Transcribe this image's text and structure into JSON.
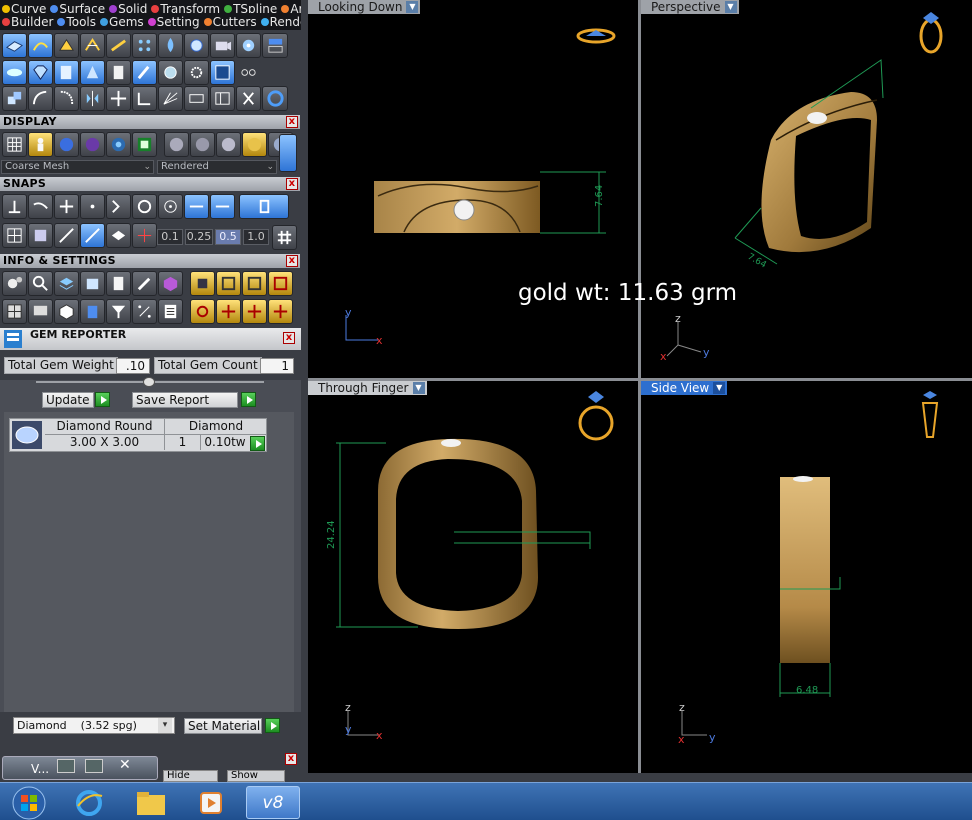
{
  "menu": {
    "row1": [
      {
        "label": "Curve",
        "dot": "#f0c000"
      },
      {
        "label": "Surface",
        "dot": "#4e8df0"
      },
      {
        "label": "Solid",
        "dot": "#a040d0"
      },
      {
        "label": "Transform",
        "dot": "#e84040"
      },
      {
        "label": "TSpline",
        "dot": "#40b040"
      },
      {
        "label": "Art",
        "dot": "#f08030"
      }
    ],
    "row2": [
      {
        "label": "Builder",
        "dot": "#e84040"
      },
      {
        "label": "Tools",
        "dot": "#4e8df0"
      },
      {
        "label": "Gems",
        "dot": "#40a0e0"
      },
      {
        "label": "Setting",
        "dot": "#d040d0"
      },
      {
        "label": "Cutters",
        "dot": "#f08030"
      },
      {
        "label": "Render",
        "dot": "#40b0f0"
      }
    ]
  },
  "sections": {
    "display": "DISPLAY",
    "snaps": "SNAPS",
    "info": "INFO & SETTINGS",
    "close": "x"
  },
  "display": {
    "mesh_select": "Coarse Mesh",
    "render_select": "Rendered"
  },
  "snaps": {
    "values": [
      "0.1",
      "0.25",
      "0.5",
      "1.0"
    ],
    "active_value": "0.5"
  },
  "gem_reporter": {
    "title": "GEM REPORTER",
    "total_weight_label": "Total Gem Weight",
    "total_weight_value": ".10",
    "total_count_label": "Total Gem Count",
    "total_count_value": "1",
    "update_label": "Update",
    "save_label": "Save Report",
    "table": {
      "header": [
        "Diamond Round",
        "Diamond"
      ],
      "row": [
        "3.00 X 3.00",
        "1",
        "0.10tw"
      ]
    },
    "material_select": "Diamond    (3.52 spg)",
    "set_material_label": "Set Material"
  },
  "bottom_bar": {
    "window_label": "V...",
    "hide_label": "Hide",
    "show_label": "Show"
  },
  "viewports": {
    "top_left": "Looking Down",
    "top_right": "Perspective",
    "bottom_left": "Through Finger",
    "bottom_right": "Side View"
  },
  "dimensions": {
    "looking_down": "7.64",
    "perspective": "7.64",
    "through_finger": "24.24",
    "side_view": "6.48"
  },
  "axes": {
    "x": "x",
    "y": "y",
    "z": "z"
  },
  "overlay": {
    "gold_weight": "gold wt: 11.63 grm"
  },
  "taskbar": {
    "app_label": "v8"
  },
  "colors": {
    "gold": "#c9a15e",
    "gold_dark": "#7d5a22",
    "dimension_line": "#1f9a55",
    "tab_blue": "#2d6fcf"
  }
}
